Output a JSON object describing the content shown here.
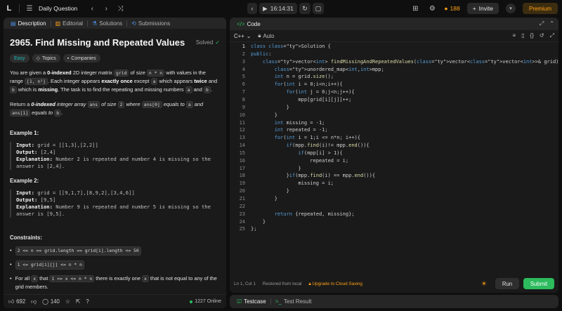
{
  "topbar": {
    "logo": "L",
    "title": "Daily Question",
    "timer": "16:14:31",
    "streak": "188",
    "invite": "Invite",
    "premium": "Premium"
  },
  "description_panel": {
    "tabs": [
      {
        "label": "Description",
        "icon": "document-icon"
      },
      {
        "label": "Editorial",
        "icon": "book-icon"
      },
      {
        "label": "Solutions",
        "icon": "flask-icon"
      },
      {
        "label": "Submissions",
        "icon": "history-icon"
      }
    ],
    "title": "2965. Find Missing and Repeated Values",
    "solved": "Solved",
    "chips": {
      "difficulty": "Easy",
      "topics": "Topics",
      "companies": "Companies"
    },
    "p1": {
      "a": "You are given a ",
      "b": "0-indexed",
      "c": " 2D integer matrix ",
      "d": "grid",
      "e": " of size ",
      "f": "n * n",
      "g": " with values in the range ",
      "h": "[1, n²]",
      "i": ". Each integer appears ",
      "j": "exactly once",
      "k": " except ",
      "l": "a",
      "m": " which appears ",
      "n": "twice",
      "o": " and ",
      "p": "b",
      "q": " which is ",
      "r": "missing",
      "s": ". The task is to find the repeating and missing numbers ",
      "t": "a",
      "u": " and ",
      "v": "b",
      "w": "."
    },
    "p2": {
      "a": "Return a ",
      "b": "0-indexed ",
      "c": "integer array ",
      "d": "ans",
      "e": " of size ",
      "f": "2",
      "g": " where ",
      "h": "ans[0]",
      "i": " equals to ",
      "j": "a",
      "k": " and ",
      "l": "ans[1]",
      "m": " equals to ",
      "n": "b",
      "o": "."
    },
    "examples": [
      {
        "title": "Example 1:",
        "input_label": "Input:",
        "input": " grid = [[1,3],[2,2]]",
        "output_label": "Output:",
        "output": " [2,4]",
        "expl_label": "Explanation:",
        "expl1": " Number 2 is repeated and number 4 is missing so the",
        "expl2": "answer is [2,4]."
      },
      {
        "title": "Example 2:",
        "input_label": "Input:",
        "input": " grid = [[9,1,7],[8,9,2],[3,4,6]]",
        "output_label": "Output:",
        "output": " [9,5]",
        "expl_label": "Explanation:",
        "expl1": " Number 9 is repeated and number 5 is missing so the",
        "expl2": "answer is [9,5]."
      }
    ],
    "constraints_title": "Constraints:",
    "constraints": {
      "c1": "2 <= n == grid.length == grid[i].length <= 50",
      "c2": "1 <= grid[i][j] <= n * n",
      "c3a": "For all ",
      "c3b": "x",
      "c3c": " that ",
      "c3d": "1 <= x <= n * n",
      "c3e": " there is exactly one ",
      "c3f": "x",
      "c3g": " that is not equal to any of the",
      "c3h": "grid members."
    },
    "footer": {
      "likes": "692",
      "comments": "140",
      "online": "1227 Online"
    }
  },
  "code_panel": {
    "title": "Code",
    "language": "C++",
    "auto": "Auto",
    "lines": [
      "class Solution {",
      "public:",
      "    vector<int> findMissingAndRepeatedValues(vector<vector<int>>& grid) {",
      "        unordered_map<int,int>mpp;",
      "        int n = grid.size();",
      "        for(int i = 0;i<n;i++){",
      "            for(int j = 0;j<n;j++){",
      "                mpp[grid[i][j]]++;",
      "            }",
      "        }",
      "        int missing = -1;",
      "        int repeated = -1;",
      "        for(int i = 1;i <= n*n; i++){",
      "            if(mpp.find(i)!= mpp.end()){",
      "                if(mpp[i] > 1){",
      "                    repeated = i;",
      "                }",
      "            }if(mpp.find(i) == mpp.end()){",
      "                missing = i;",
      "            }",
      "        }",
      "",
      "        return {repeated, missing};",
      "    }",
      "};"
    ],
    "status": {
      "position": "Ln 1, Col 1",
      "restored": "Restored from local",
      "upgrade": "Upgrade to Cloud Saving"
    },
    "run": "Run",
    "submit": "Submit"
  },
  "bottom_panel": {
    "testcase": "Testcase",
    "test_result": "Test Result"
  },
  "colors": {
    "accent": "#ffa116",
    "submit": "#2cbb5d",
    "easy": "#1cbaba",
    "keyword": "#569cd6",
    "type": "#4ec9b0"
  }
}
